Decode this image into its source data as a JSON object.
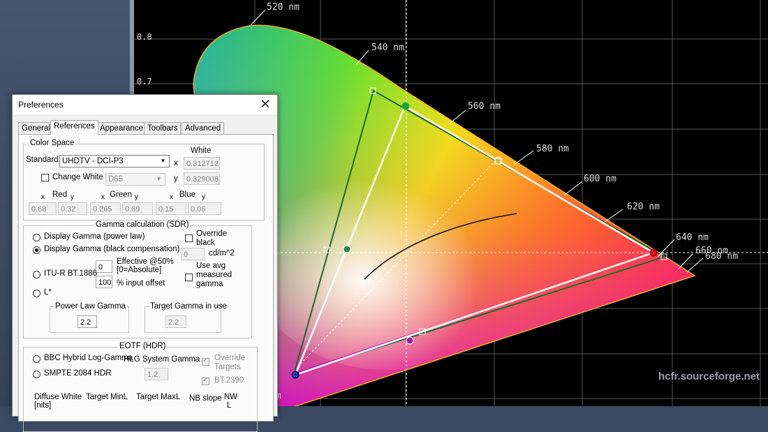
{
  "chart": {
    "wavelength_labels": [
      "520 nm",
      "540 nm",
      "560 nm",
      "580 nm",
      "600 nm",
      "620 nm",
      "640 nm",
      "660 nm",
      "680 nm"
    ],
    "tick_labels": [
      "0.8",
      "0.7"
    ],
    "watermark": "hcfr.sourceforge.net",
    "clipped_label": "m"
  },
  "dialog": {
    "title": "Preferences",
    "close_glyph": "✕",
    "tabs": [
      "General",
      "References",
      "Appearance",
      "Toolbars",
      "Advanced"
    ],
    "active_tab": "References",
    "color_space": {
      "group_label": "Color Space",
      "standard_label": "Standard:",
      "standard_value": "UHDTV - DCI-P3",
      "change_white_label": "Change White",
      "white_combo": "D65",
      "white_label": "White",
      "x_label": "x",
      "y_label": "y",
      "white_x": "0.312712",
      "white_y": "0.329008",
      "red_label": "Red",
      "green_label": "Green",
      "blue_label": "Blue",
      "red_x": "0.68",
      "red_y": "0.32",
      "green_x": "0.265",
      "green_y": "0.69",
      "blue_x": "0.15",
      "blue_y": "0.06"
    },
    "gamma": {
      "group_label": "Gamma calculation (SDR)",
      "opt_power": "Display Gamma (power law)",
      "opt_black": "Display Gamma (black compensation)",
      "opt_bt1886": "ITU-R BT.1886",
      "opt_lstar": "L*",
      "effective_value": "0",
      "effective_label_1": "Effective @50%",
      "effective_label_2": "[0=Absolute]",
      "input_offset_value": "100",
      "input_offset_label": "% input offset",
      "override_black_1": "Override",
      "override_black_2": "black",
      "black_value": "0",
      "black_unit": "cd/m^2",
      "use_avg_1": "Use avg",
      "use_avg_2": "measured",
      "use_avg_3": "gamma",
      "power_law_label": "Power Law Gamma",
      "power_law_value": "2.2",
      "target_label": "Target Gamma in use",
      "target_value": "2.2"
    },
    "eotf": {
      "group_label": "EOTF (HDR)",
      "opt_hlg": "BBC Hybrid Log-Gamma",
      "hlg_system_label": "HLG System Gamma",
      "hlg_value": "1.2",
      "opt_pq": "SMPTE 2084 HDR",
      "override_targets_1": "Override",
      "override_targets_2": "Targets",
      "bt2390_label": "BT.2390",
      "diffuse_white_1": "Diffuse White",
      "diffuse_white_2": "[nits]",
      "target_minl": "Target MinL",
      "target_maxl": "Target MaxL",
      "nb_slope": "NB slope",
      "nw_1": "NW",
      "nw_2": "L"
    }
  }
}
